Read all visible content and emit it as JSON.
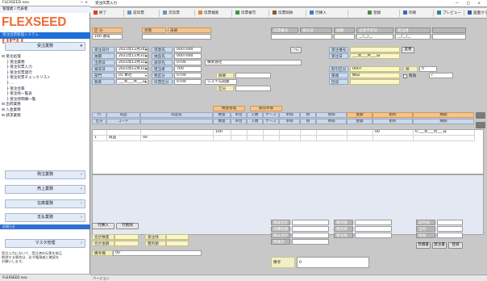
{
  "left": {
    "window_title": "FLEXSEED neo",
    "window_controls": "— ×",
    "user_line": "管理者 / 代表者",
    "logo_text": "FLEXSEED neo",
    "logo_sub": "受注出荷管理システム",
    "nav_top": "受注業務",
    "tree": [
      "受注処理",
      "受注業務",
      "受注伝票入力",
      "受注伝票発行",
      "受注伝票チェックリスト",
      "…",
      "受注台帳",
      "受注残一覧表",
      "受注残明細一覧",
      "出荷業務",
      "入金業務",
      "請求業務"
    ],
    "nav_bottom": [
      {
        "label": "発注業務"
      },
      {
        "label": "売上業務"
      },
      {
        "label": "在庫業務"
      },
      {
        "label": "支払業務"
      },
      {
        "label": "マスタ管理"
      }
    ],
    "blue_label": "お知らせ",
    "note": "受注入力において、受注済の伝票を修正\n削除する場合は、必ず権限者に確認を\nお願いします。",
    "status": "FLEXSEED neo"
  },
  "main": {
    "title": "受注伝票入力",
    "controls": "— □ ×",
    "toolbar": [
      {
        "label": "終了",
        "color": "#e03a2f"
      },
      {
        "label": "前伝票",
        "color": "#6d8fc7"
      },
      {
        "label": "次伝票",
        "color": "#6d8fc7"
      },
      {
        "label": "伝票検索",
        "color": "#e08a2f"
      },
      {
        "label": "伝票複写",
        "color": "#3a9a3a"
      },
      {
        "label": "伝票削除",
        "color": "#8a5a2a"
      },
      {
        "label": "行挿入",
        "color": "#3a7ad0"
      },
      {
        "label": "登録",
        "color": "#4a8a4a"
      },
      {
        "label": "印刷",
        "color": "#3a6ac0"
      },
      {
        "label": "プレビュー",
        "color": "#2a8a8a"
      },
      {
        "label": "画面クリア",
        "color": "#3a5ab0"
      }
    ],
    "header_row1": {
      "kubun_label": "区 分",
      "kubun_value": "100 通常",
      "status_label": "状態",
      "status_value": "未締",
      "denpyo_label": "伝票番号",
      "denpyo_value": "",
      "date_label": "受注日",
      "date_value": "2021年12月24日",
      "nouki_label": "納期",
      "nouki_value": "2021年12月31日",
      "shukka_label": "出荷予定日",
      "shukka_value": "__/__/__",
      "tantou_label": "担当者",
      "tantou_value": "__/__/__"
    },
    "header_rows": [
      {
        "label": "受注日付",
        "value": "2021年12月24日",
        "label2": "得意先",
        "value2": "0007000"
      },
      {
        "label": "納期",
        "value": "2021年12月31日",
        "label2": "納品先",
        "value2": "0007000"
      },
      {
        "label": "出荷日",
        "value": "2021年12月31日",
        "label2": "請求先",
        "value2": "0700"
      },
      {
        "label": "検収日",
        "value": "2021年12月31日",
        "label2": "担当者",
        "value2": "700"
      },
      {
        "label": "部門",
        "value": "01 本社",
        "label2": "税区分",
        "value2": "0700"
      },
      {
        "label": "税率",
        "value": "___年___月___日",
        "label2": "伝票区分",
        "value2": "0700"
      }
    ],
    "name_value": "株式会社",
    "right_fields": [
      {
        "label": "受注番号",
        "value": ""
      },
      {
        "label": "受注日",
        "value": "___年___月___日"
      },
      {
        "label": "取引区分",
        "value": "0007"
      },
      {
        "label": "帳端",
        "value": "締日"
      },
      {
        "label": "回収",
        "value": ""
      }
    ],
    "right_extra": {
      "label_a": "締",
      "value_a": "0",
      "label_b": "日付",
      "value_b": "/",
      "check_label": "有効",
      "edit_button": "変更"
    },
    "mid_labels": {
      "sub1": "摘要",
      "sub2": "プロジェクト",
      "sub2_value": "システム開発",
      "sub3": "区分",
      "sub4": "受注種別",
      "sub5": "納入場所"
    },
    "grid_top_groups": [
      {
        "label": "数量管理"
      },
      {
        "label": "販売単価"
      }
    ],
    "grid_headers": [
      {
        "label": "行"
      },
      {
        "label": "商品"
      },
      {
        "label": "商品名"
      },
      {
        "label": "数量"
      },
      {
        "label": "単位"
      },
      {
        "label": "入数"
      },
      {
        "label": "ケース"
      },
      {
        "label": "単価"
      },
      {
        "label": "税"
      },
      {
        "label": "原価"
      },
      {
        "label": "金額"
      },
      {
        "label": "粗利"
      },
      {
        "label": "納期"
      }
    ],
    "grid_headers2": [
      "区分",
      "コード",
      "",
      "数量",
      "単位",
      "入数",
      "ケース",
      "単価",
      "税",
      "原価",
      "金額",
      "粗利",
      "納期"
    ],
    "grid_rows": [
      {
        "c1": "",
        "c2": "",
        "c3": "",
        "c4": "100",
        "c5": "",
        "c6": "",
        "c7": "",
        "c8": "",
        "c9": "",
        "c10": "",
        "c11": "",
        "c12": "00",
        "c13": "0 ___年___月___日"
      },
      {
        "c1": "1",
        "c2": "商品",
        "c3": "00",
        "c4": "",
        "c5": "",
        "c6": "",
        "c7": "",
        "c8": "",
        "c9": "",
        "c10": "",
        "c11": "",
        "c12": "",
        "c13": ""
      }
    ],
    "bottom": {
      "btn_add": "行挿入",
      "btn_del": "行削除",
      "left_fields": [
        {
          "label": "合計数量",
          "value": ""
        },
        {
          "label": "合計金額",
          "value": ""
        },
        {
          "label": "受注残",
          "value": ""
        },
        {
          "label": "粗利額",
          "value": ""
        }
      ],
      "bikou_label": "備考欄",
      "bikou_value": "00",
      "sum_labels": [
        "税抜合計",
        "消費税額",
        "税込合計",
        "原価計"
      ],
      "sum_labels2": [
        "粗利額",
        "粗利率",
        "受注残"
      ],
      "right_labels": [
        "前月残",
        "当月",
        "残高"
      ],
      "right_buttons": [
        "見積書",
        "発注書",
        "登録"
      ],
      "memo_label": "備考",
      "memo_value": "0"
    }
  },
  "status_bar": "バージョン"
}
